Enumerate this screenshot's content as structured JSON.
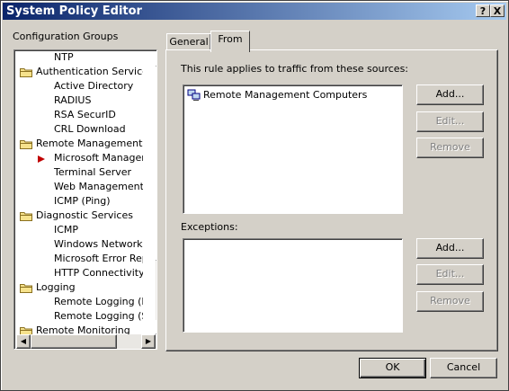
{
  "window": {
    "title": "System Policy Editor",
    "help_label": "?",
    "close_label": "X"
  },
  "sidebar": {
    "label": "Configuration Groups",
    "items": [
      {
        "label": "NTP",
        "level": 1
      },
      {
        "label": "Authentication Services",
        "level": 0
      },
      {
        "label": "Active Directory",
        "level": 1
      },
      {
        "label": "RADIUS",
        "level": 1
      },
      {
        "label": "RSA SecurID",
        "level": 1
      },
      {
        "label": "CRL Download",
        "level": 1
      },
      {
        "label": "Remote Management",
        "level": 0
      },
      {
        "label": "Microsoft Management",
        "level": 1,
        "selected": true
      },
      {
        "label": "Terminal Server",
        "level": 1
      },
      {
        "label": "Web Management",
        "level": 1
      },
      {
        "label": "ICMP (Ping)",
        "level": 1
      },
      {
        "label": "Diagnostic Services",
        "level": 0
      },
      {
        "label": "ICMP",
        "level": 1
      },
      {
        "label": "Windows Networking",
        "level": 1
      },
      {
        "label": "Microsoft Error Reporting",
        "level": 1
      },
      {
        "label": "HTTP Connectivity verifiers",
        "level": 1
      },
      {
        "label": "Logging",
        "level": 0
      },
      {
        "label": "Remote Logging (NetBIOS)",
        "level": 1
      },
      {
        "label": "Remote Logging (SQL)",
        "level": 1
      },
      {
        "label": "Remote Monitoring",
        "level": 0
      }
    ]
  },
  "tabs": [
    {
      "label": "General",
      "active": false
    },
    {
      "label": "From",
      "active": true
    }
  ],
  "from_tab": {
    "sources_label": "This rule applies to traffic from these sources:",
    "sources": [
      "Remote Management Computers"
    ],
    "exceptions_label": "Exceptions:",
    "add_label": "Add...",
    "edit_label": "Edit...",
    "remove_label": "Remove"
  },
  "footer": {
    "ok_label": "OK",
    "cancel_label": "Cancel"
  },
  "colors": {
    "titlebar_start": "#0a246a",
    "titlebar_end": "#a6caf0",
    "face": "#d4d0c8",
    "arrow": "#c00000"
  }
}
